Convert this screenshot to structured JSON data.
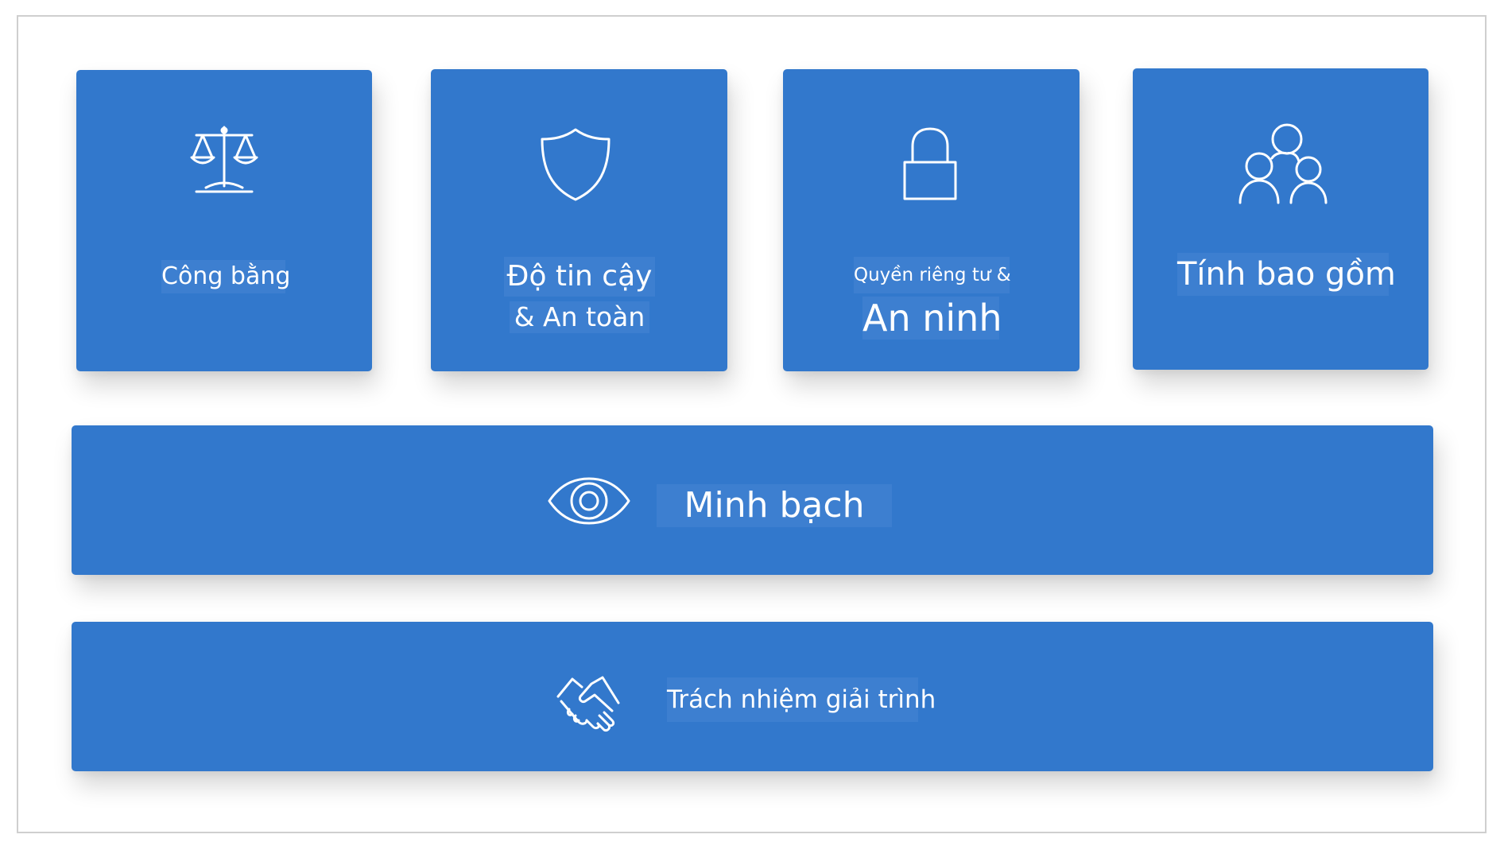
{
  "principles": {
    "fairness": {
      "label": "Công bằng",
      "icon": "scales-icon"
    },
    "reliability": {
      "line1": "Độ tin cậy",
      "line2": "& An toàn",
      "icon": "shield-icon"
    },
    "privacy": {
      "line1": "Quyền riêng tư &",
      "line2": "An ninh",
      "icon": "lock-icon"
    },
    "inclusiveness": {
      "label": "Tính bao gồm",
      "icon": "people-icon"
    },
    "transparency": {
      "label": "Minh bạch",
      "icon": "eye-icon"
    },
    "accountability": {
      "label": "Trách nhiệm giải trình",
      "icon": "handshake-icon"
    }
  },
  "colors": {
    "card": "#3278cc",
    "label_bg": "#3d7fd0",
    "text": "#ffffff",
    "frame_border": "#cfcfcf"
  }
}
